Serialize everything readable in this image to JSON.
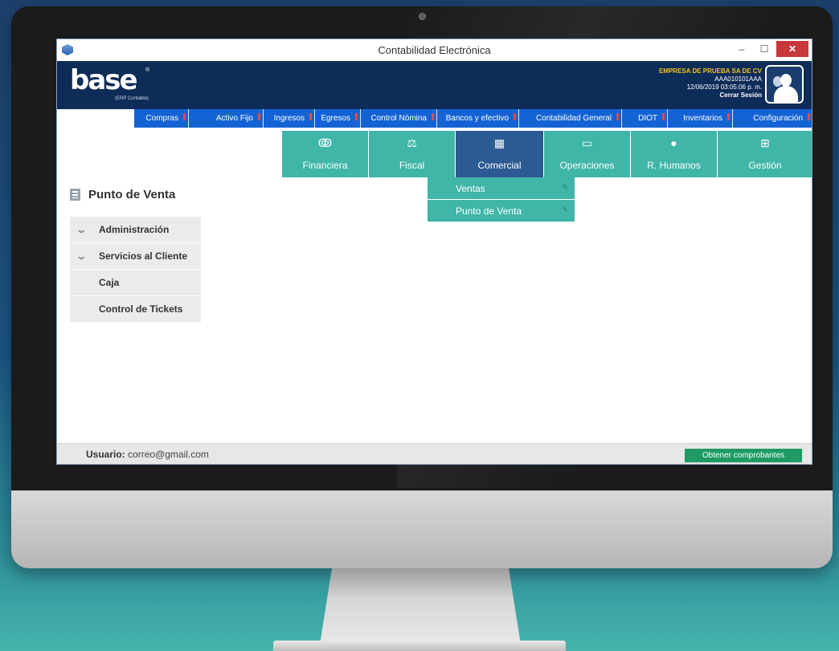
{
  "window": {
    "title": "Contabilidad Electrónica"
  },
  "header": {
    "logo_word": "base",
    "logo_reg": "®",
    "logo_sub": "(ERP Contable)",
    "company_name": "EMPRESA DE PRUEBA SA DE CV",
    "rfc": "AAA010101AAA",
    "datetime": "12/06/2019 03:05:06 p. m.",
    "logout": "Cerrar Sesión"
  },
  "modules": [
    {
      "label": "Compras"
    },
    {
      "label": "Activo Fijo"
    },
    {
      "label": "Ingresos"
    },
    {
      "label": "Egresos"
    },
    {
      "label": "Control Nómina"
    },
    {
      "label": "Bancos y efectivo"
    },
    {
      "label": "Contabilidad General"
    },
    {
      "label": "DIOT"
    },
    {
      "label": "Inventarios"
    },
    {
      "label": "Configuración"
    }
  ],
  "categories": [
    {
      "label": "Financiera",
      "icon": "link-icon"
    },
    {
      "label": "Fiscal",
      "icon": "scale-icon"
    },
    {
      "label": "Comercial",
      "icon": "building-icon"
    },
    {
      "label": "Operaciones",
      "icon": "monitor-icon"
    },
    {
      "label": "R. Humanos",
      "icon": "person-icon"
    },
    {
      "label": "Gestión",
      "icon": "org-chart-icon"
    }
  ],
  "dropdown": [
    {
      "label": "Ventas"
    },
    {
      "label": "Punto de Venta"
    }
  ],
  "page": {
    "title": "Punto de Venta"
  },
  "sidebar": [
    {
      "label": "Administración"
    },
    {
      "label": "Servicios al Cliente"
    },
    {
      "label": "Caja"
    },
    {
      "label": "Control de Tickets"
    }
  ],
  "status": {
    "user_label": "Usuario:",
    "user_email": "correo@gmail.com",
    "action_button": "Obtener comprobantes"
  },
  "colors": {
    "header": "#0e2c58",
    "module": "#1463d5",
    "category": "#3fb6a8",
    "active_category": "#2c5a92",
    "action": "#1e9b64"
  }
}
